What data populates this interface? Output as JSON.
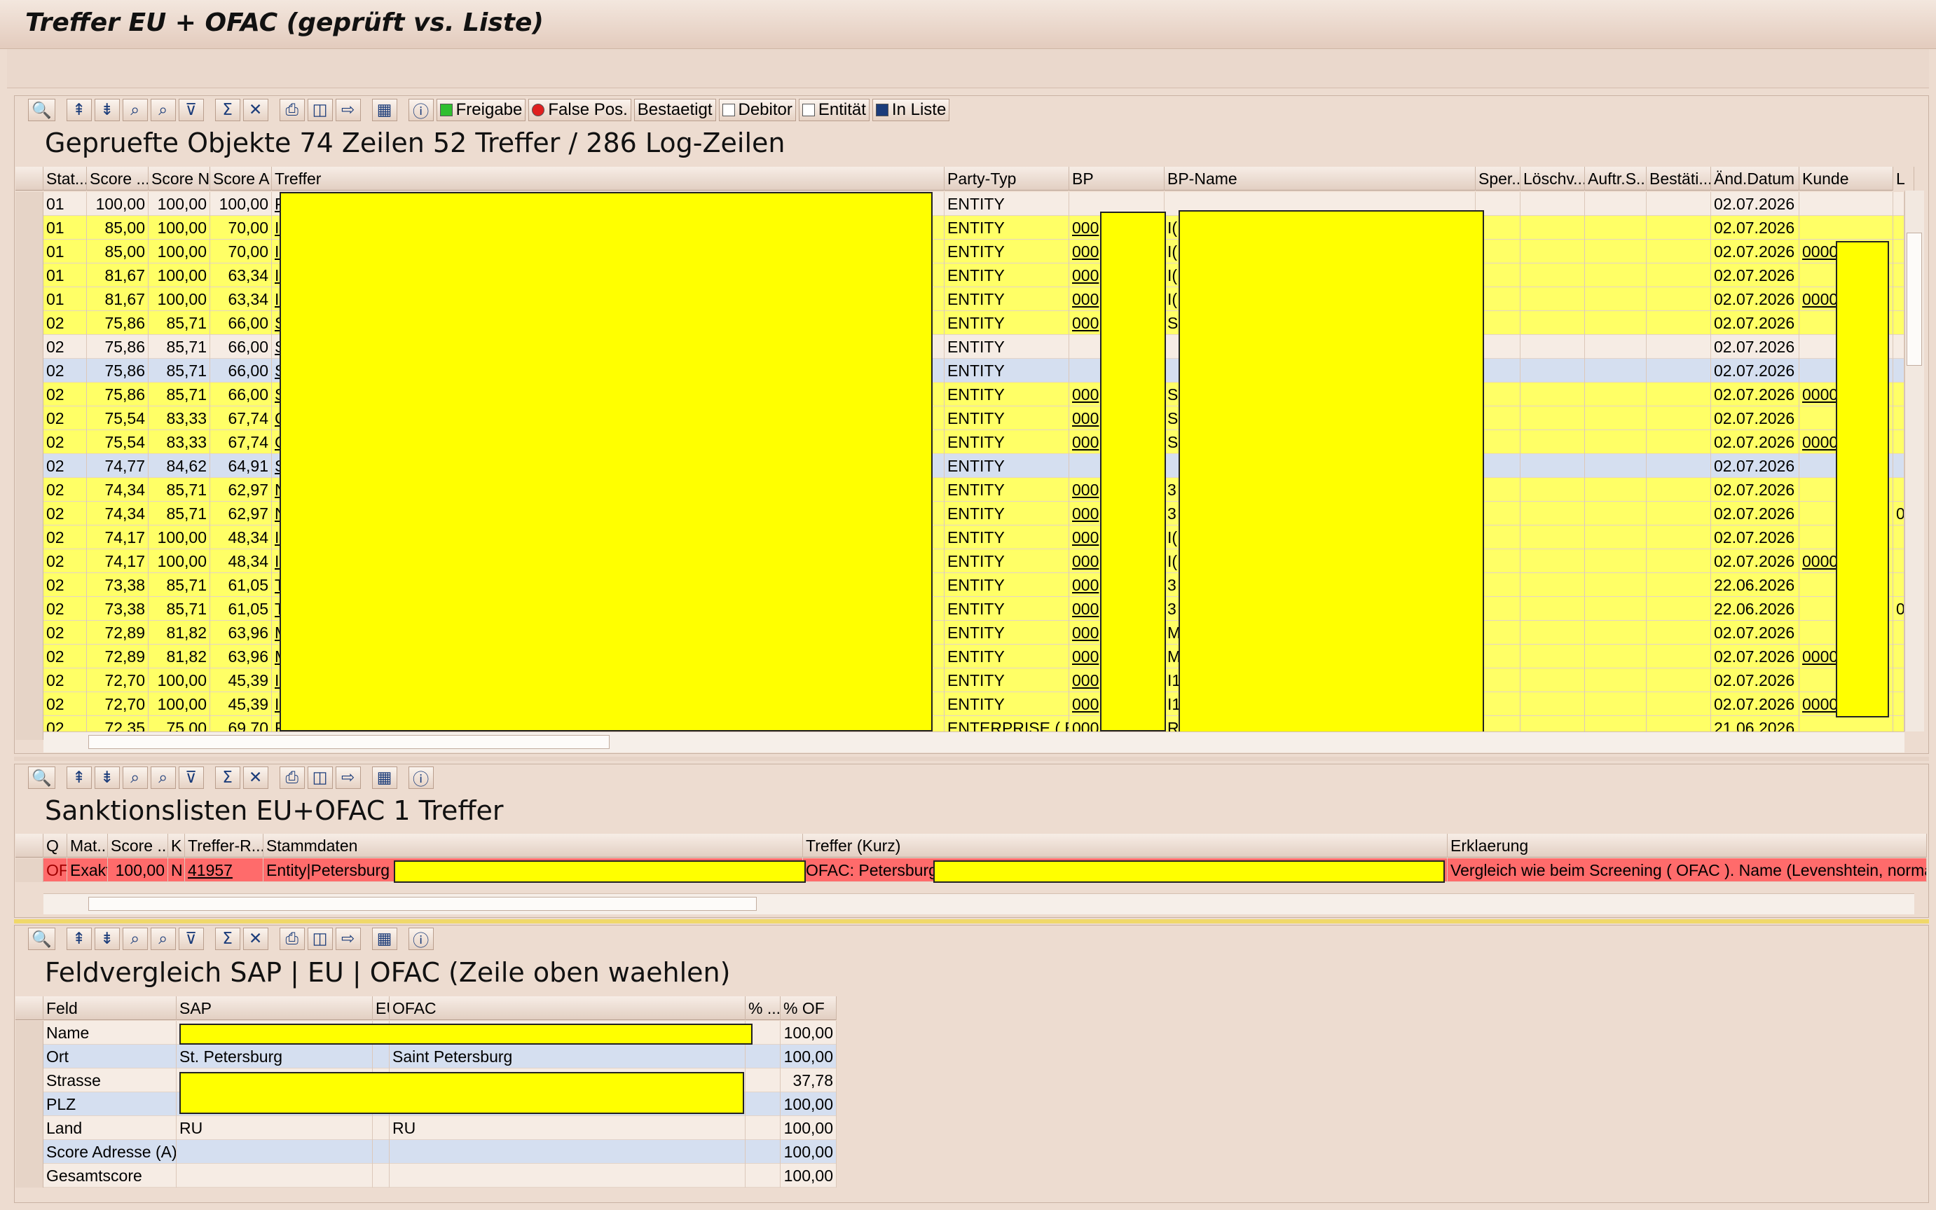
{
  "window_title": "Treffer EU + OFAC (geprüft vs. Liste)",
  "colors": {
    "yellow": "#ffff66",
    "red": "#ff6b6b",
    "blue": "#d5dff0",
    "mask": "#ffff00"
  },
  "toolbar_icons": [
    "details-icon",
    "sort-asc-icon",
    "sort-desc-icon",
    "find-icon",
    "find-next-icon",
    "filter-icon",
    "sum-icon",
    "subtotal-icon",
    "print-icon",
    "views-icon",
    "export-icon",
    "layout-icon",
    "info-icon"
  ],
  "top": {
    "title": "Gepruefte Objekte 74 Zeilen 52 Treffer / 286 Log-Zeilen",
    "buttons": {
      "freigabe": "Freigabe",
      "false_pos": "False Pos.",
      "bestaetigt": "Bestaetigt",
      "debitor": "Debitor",
      "entitaet": "Entität",
      "in_liste": "In Liste"
    },
    "columns": {
      "stat": "Stat...",
      "score": "Score ...",
      "score_n": "Score N",
      "score_a": "Score A",
      "treffer": "Treffer",
      "party": "Party-Typ",
      "bp": "BP",
      "bpname": "BP-Name",
      "sper": "Sper...",
      "loesch": "Löschv...",
      "auftr": "Auftr.S...",
      "best": "Bestäti...",
      "datum": "Änd.Datum",
      "kunde": "Kunde",
      "l": "L"
    },
    "rows": [
      {
        "stat": "01",
        "score": "100,00",
        "n": "100,00",
        "a": "100,00",
        "t": "P",
        "party": "ENTITY",
        "bp": "",
        "bpn": "",
        "d": "02.07.2026",
        "k": "",
        "l": "",
        "bg": "white"
      },
      {
        "stat": "01",
        "score": "85,00",
        "n": "100,00",
        "a": "70,00",
        "t": "Ir",
        "party": "ENTITY",
        "bp": "000",
        "bpn": "I(",
        "d": "02.07.2026",
        "k": "",
        "l": "",
        "bg": "yellow"
      },
      {
        "stat": "01",
        "score": "85,00",
        "n": "100,00",
        "a": "70,00",
        "t": "Ir",
        "party": "ENTITY",
        "bp": "000",
        "bpn": "I(",
        "d": "02.07.2026",
        "k": "0000",
        "l": "",
        "bg": "yellow"
      },
      {
        "stat": "01",
        "score": "81,67",
        "n": "100,00",
        "a": "63,34",
        "t": "Ir",
        "party": "ENTITY",
        "bp": "000",
        "bpn": "I(",
        "d": "02.07.2026",
        "k": "",
        "l": "",
        "bg": "yellow"
      },
      {
        "stat": "01",
        "score": "81,67",
        "n": "100,00",
        "a": "63,34",
        "t": "Ir",
        "party": "ENTITY",
        "bp": "000",
        "bpn": "I(",
        "d": "02.07.2026",
        "k": "0000",
        "l": "",
        "bg": "yellow"
      },
      {
        "stat": "02",
        "score": "75,86",
        "n": "85,71",
        "a": "66,00",
        "t": "S",
        "party": "ENTITY",
        "bp": "000",
        "bpn": "S",
        "d": "02.07.2026",
        "k": "",
        "l": "",
        "bg": "yellow"
      },
      {
        "stat": "02",
        "score": "75,86",
        "n": "85,71",
        "a": "66,00",
        "t": "S",
        "party": "ENTITY",
        "bp": "",
        "bpn": "",
        "d": "02.07.2026",
        "k": "",
        "l": "",
        "bg": "white"
      },
      {
        "stat": "02",
        "score": "75,86",
        "n": "85,71",
        "a": "66,00",
        "t": "S",
        "party": "ENTITY",
        "bp": "",
        "bpn": "",
        "d": "02.07.2026",
        "k": "",
        "l": "",
        "bg": "blue"
      },
      {
        "stat": "02",
        "score": "75,86",
        "n": "85,71",
        "a": "66,00",
        "t": "S",
        "party": "ENTITY",
        "bp": "000",
        "bpn": "S",
        "d": "02.07.2026",
        "k": "0000",
        "l": "",
        "bg": "yellow"
      },
      {
        "stat": "02",
        "score": "75,54",
        "n": "83,33",
        "a": "67,74",
        "t": "C",
        "party": "ENTITY",
        "bp": "000",
        "bpn": "S",
        "d": "02.07.2026",
        "k": "",
        "l": "",
        "bg": "yellow"
      },
      {
        "stat": "02",
        "score": "75,54",
        "n": "83,33",
        "a": "67,74",
        "t": "C",
        "party": "ENTITY",
        "bp": "000",
        "bpn": "S",
        "d": "02.07.2026",
        "k": "0000",
        "l": "",
        "bg": "yellow"
      },
      {
        "stat": "02",
        "score": "74,77",
        "n": "84,62",
        "a": "64,91",
        "t": "S",
        "party": "ENTITY",
        "bp": "",
        "bpn": "",
        "d": "02.07.2026",
        "k": "",
        "l": "",
        "bg": "blue"
      },
      {
        "stat": "02",
        "score": "74,34",
        "n": "85,71",
        "a": "62,97",
        "t": "N",
        "party": "ENTITY",
        "bp": "000",
        "bpn": "3",
        "d": "02.07.2026",
        "k": "",
        "l": "",
        "bg": "yellow"
      },
      {
        "stat": "02",
        "score": "74,34",
        "n": "85,71",
        "a": "62,97",
        "t": "N",
        "party": "ENTITY",
        "bp": "000",
        "bpn": "3",
        "d": "02.07.2026",
        "k": "",
        "l": "0",
        "bg": "yellow"
      },
      {
        "stat": "02",
        "score": "74,17",
        "n": "100,00",
        "a": "48,34",
        "t": "Ir",
        "party": "ENTITY",
        "bp": "000",
        "bpn": "I(",
        "d": "02.07.2026",
        "k": "",
        "l": "",
        "bg": "yellow"
      },
      {
        "stat": "02",
        "score": "74,17",
        "n": "100,00",
        "a": "48,34",
        "t": "Ir",
        "party": "ENTITY",
        "bp": "000",
        "bpn": "I(",
        "d": "02.07.2026",
        "k": "0000",
        "l": "",
        "bg": "yellow"
      },
      {
        "stat": "02",
        "score": "73,38",
        "n": "85,71",
        "a": "61,05",
        "t": "T",
        "party": "ENTITY",
        "bp": "000",
        "bpn": "3",
        "d": "22.06.2026",
        "k": "",
        "l": "",
        "bg": "yellow"
      },
      {
        "stat": "02",
        "score": "73,38",
        "n": "85,71",
        "a": "61,05",
        "t": "T",
        "party": "ENTITY",
        "bp": "000",
        "bpn": "3",
        "d": "22.06.2026",
        "k": "",
        "l": "0",
        "bg": "yellow"
      },
      {
        "stat": "02",
        "score": "72,89",
        "n": "81,82",
        "a": "63,96",
        "t": "M",
        "party": "ENTITY",
        "bp": "000",
        "bpn": "M",
        "d": "02.07.2026",
        "k": "",
        "l": "",
        "bg": "yellow"
      },
      {
        "stat": "02",
        "score": "72,89",
        "n": "81,82",
        "a": "63,96",
        "t": "M",
        "party": "ENTITY",
        "bp": "000",
        "bpn": "M",
        "d": "02.07.2026",
        "k": "0000",
        "l": "",
        "bg": "yellow"
      },
      {
        "stat": "02",
        "score": "72,70",
        "n": "100,00",
        "a": "45,39",
        "t": "II",
        "party": "ENTITY",
        "bp": "000",
        "bpn": "I1",
        "d": "02.07.2026",
        "k": "",
        "l": "",
        "bg": "yellow"
      },
      {
        "stat": "02",
        "score": "72,70",
        "n": "100,00",
        "a": "45,39",
        "t": "II",
        "party": "ENTITY",
        "bp": "000",
        "bpn": "I1",
        "d": "02.07.2026",
        "k": "0000",
        "l": "",
        "bg": "yellow"
      },
      {
        "stat": "02",
        "score": "72,35",
        "n": "75,00",
        "a": "69,70",
        "t": "R",
        "party": "ENTERPRISE ( E )",
        "bp": "000",
        "bpn": "R",
        "d": "21.06.2026",
        "k": "",
        "l": "",
        "bg": "yellow"
      }
    ]
  },
  "mid": {
    "title": "Sanktionslisten EU+OFAC 1 Treffer",
    "columns": {
      "q": "Q",
      "mat": "Mat...",
      "score": "Score ...",
      "k": "K",
      "ref": "Treffer-R...",
      "stamm": "Stammdaten",
      "kurz": "Treffer (Kurz)",
      "erkl": "Erklaerung"
    },
    "row": {
      "q": "OF",
      "mat": "Exakt",
      "score": "100,00",
      "k": "N",
      "ref": "41957",
      "stamm": "Entity|Petersburg",
      "kurz": "OFAC: Petersburg",
      "erkl": "Vergleich wie beim Screening ( OFAC ). Name (Levenshtein, normal"
    }
  },
  "bottom": {
    "title": "Feldvergleich SAP | EU | OFAC (Zeile oben waehlen)",
    "columns": {
      "feld": "Feld",
      "sap": "SAP",
      "eu": "EU",
      "ofac": "OFAC",
      "pct": "% ...",
      "pof": "% OF"
    },
    "rows": [
      {
        "feld": "Name",
        "sap": "",
        "ofac": "",
        "pof": "100,00",
        "bg": "white"
      },
      {
        "feld": "Ort",
        "sap": "St. Petersburg",
        "ofac": "Saint Petersburg",
        "pof": "100,00",
        "bg": "blue"
      },
      {
        "feld": "Strasse",
        "sap": "",
        "ofac": "",
        "pof": "37,78",
        "bg": "white"
      },
      {
        "feld": "PLZ",
        "sap": "",
        "ofac": "",
        "pof": "100,00",
        "bg": "blue"
      },
      {
        "feld": "Land",
        "sap": "RU",
        "ofac": "RU",
        "pof": "100,00",
        "bg": "white"
      },
      {
        "feld": "Score Adresse (A)",
        "sap": "",
        "ofac": "",
        "pof": "100,00",
        "bg": "blue"
      },
      {
        "feld": "Gesamtscore",
        "sap": "",
        "ofac": "",
        "pof": "100,00",
        "bg": "white"
      }
    ]
  }
}
